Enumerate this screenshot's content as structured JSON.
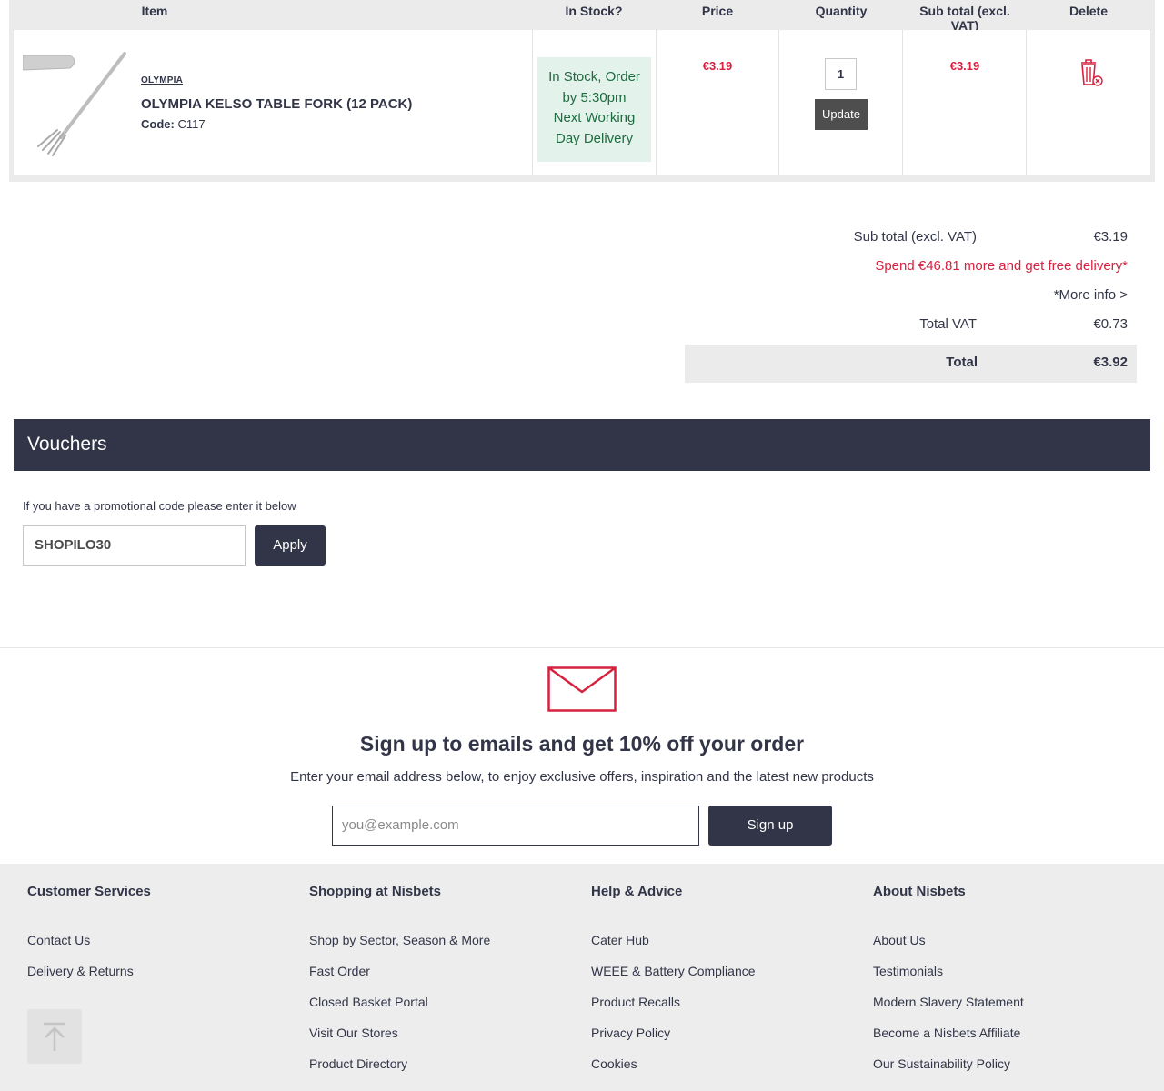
{
  "table": {
    "headers": {
      "item": "Item",
      "in_stock": "In Stock?",
      "price": "Price",
      "quantity": "Quantity",
      "subtotal": "Sub total (excl. VAT)",
      "delete": "Delete"
    },
    "rows": [
      {
        "brand": "OLYMPIA",
        "name": "OLYMPIA KELSO TABLE FORK (12 PACK)",
        "code_label": "Code:",
        "code": "C117",
        "stock_line1": "In Stock, Order",
        "stock_line2": "by 5:30pm",
        "stock_line3": "Next Working",
        "stock_line4": "Day Delivery",
        "price": "€3.19",
        "quantity": "1",
        "update_label": "Update",
        "subtotal": "€3.19"
      }
    ]
  },
  "summary": {
    "subtotal_label": "Sub total (excl. VAT)",
    "subtotal_value": "€3.19",
    "free_delivery": "Spend €46.81 more and get free delivery*",
    "more_info": "*More info >",
    "vat_label": "Total VAT",
    "vat_value": "€0.73",
    "total_label": "Total",
    "total_value": "€3.92"
  },
  "vouchers": {
    "title": "Vouchers",
    "help": "If you have a promotional code please enter it below",
    "code_value": "SHOPILO30",
    "apply_label": "Apply"
  },
  "newsletter": {
    "title": "Sign up to emails and get 10% off your order",
    "subtitle": "Enter your email address below, to enjoy exclusive offers, inspiration and the latest new products",
    "placeholder": "you@example.com",
    "button": "Sign up"
  },
  "footer": {
    "columns": [
      {
        "heading": "Customer Services",
        "links": [
          "Contact Us",
          "Delivery & Returns"
        ]
      },
      {
        "heading": "Shopping at Nisbets",
        "links": [
          "Shop by Sector, Season & More",
          "Fast Order",
          "Closed Basket Portal",
          "Visit Our Stores",
          "Product Directory"
        ]
      },
      {
        "heading": "Help & Advice",
        "links": [
          "Cater Hub",
          "WEEE & Battery Compliance",
          "Product Recalls",
          "Privacy Policy",
          "Cookies"
        ]
      },
      {
        "heading": "About Nisbets",
        "links": [
          "About Us",
          "Testimonials",
          "Modern Slavery Statement",
          "Become a Nisbets Affiliate",
          "Our Sustainability Policy"
        ]
      }
    ]
  },
  "colors": {
    "navy": "#323548",
    "accent_red": "#d6213f",
    "stock_green_bg": "#e3f3ec",
    "stock_green_text": "#1d6b3e"
  },
  "icons": {
    "product": "product-image-fork",
    "delete": "trash-icon",
    "newsletter": "envelope-icon",
    "scroll": "arrow-up-icon"
  }
}
